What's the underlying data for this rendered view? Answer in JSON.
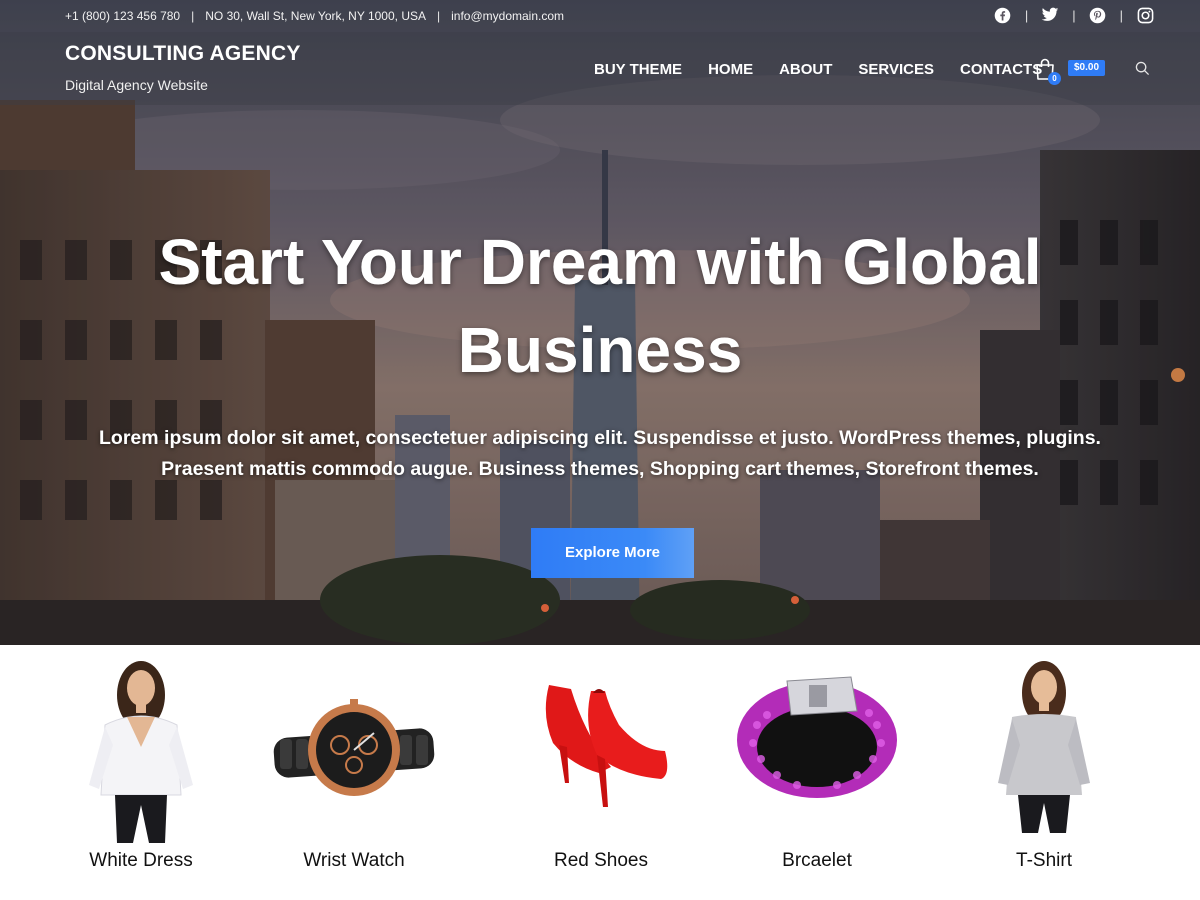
{
  "topbar": {
    "phone": "+1 (800) 123 456 780",
    "address": "NO 30, Wall St, New York, NY 1000, USA",
    "email": "info@mydomain.com",
    "separator": "|",
    "social": [
      "facebook-icon",
      "twitter-icon",
      "pinterest-icon",
      "instagram-icon"
    ]
  },
  "header": {
    "site_title": "CONSULTING AGENCY",
    "tagline": "Digital Agency Website",
    "nav": [
      "BUY THEME",
      "HOME",
      "ABOUT",
      "SERVICES",
      "CONTACTS"
    ],
    "cart_count": "0",
    "cart_total": "$0.00",
    "icons": {
      "cart": "shopping-bag-icon",
      "search": "search-icon"
    }
  },
  "hero": {
    "heading_line1": "Start Your Dream with Global",
    "heading_line2": "Business",
    "text_line1": "Lorem ipsum dolor sit amet, consectetuer adipiscing elit. Suspendisse et justo. WordPress themes, plugins.",
    "text_line2": "Praesent mattis commodo augue. Business themes, Shopping cart themes, Storefront themes.",
    "button": "Explore More"
  },
  "products": [
    {
      "name": "White Dress"
    },
    {
      "name": "Wrist Watch"
    },
    {
      "name": "Red Shoes"
    },
    {
      "name": "Brcaelet"
    },
    {
      "name": "T-Shirt"
    }
  ],
  "colors": {
    "accent": "#2f7cf6",
    "text_dark": "#111111",
    "white": "#ffffff"
  }
}
